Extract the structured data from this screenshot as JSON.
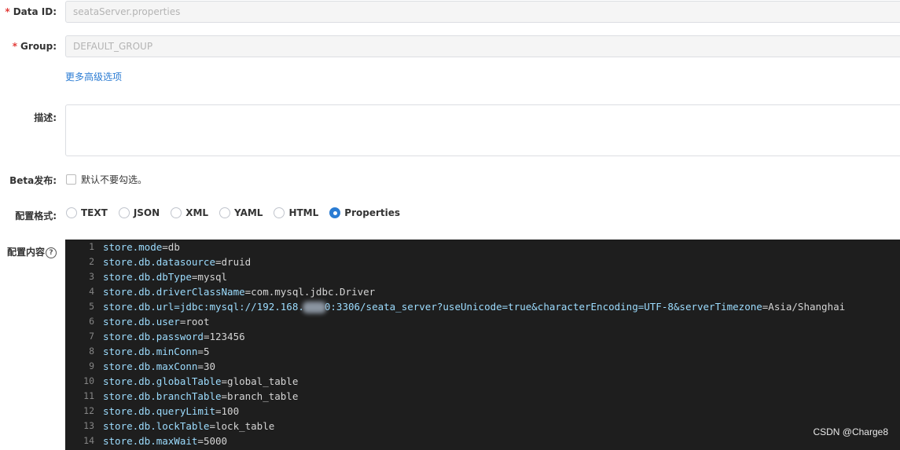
{
  "form": {
    "data_id": {
      "label": "Data ID:",
      "value": "seataServer.properties"
    },
    "group": {
      "label": "Group:",
      "value": "DEFAULT_GROUP"
    },
    "more_options_link": "更多高级选项",
    "description": {
      "label": "描述:",
      "value": ""
    },
    "beta": {
      "label": "Beta发布:",
      "checkbox_text": "默认不要勾选。",
      "checked": false
    },
    "format": {
      "label": "配置格式:",
      "options": [
        "TEXT",
        "JSON",
        "XML",
        "YAML",
        "HTML",
        "Properties"
      ],
      "selected": "Properties"
    },
    "content": {
      "label": "配置内容"
    }
  },
  "editor": {
    "lines": [
      {
        "n": "1",
        "key": "store.mode",
        "val": "=db"
      },
      {
        "n": "2",
        "key": "store.db.datasource",
        "val": "=druid"
      },
      {
        "n": "3",
        "key": "store.db.dbType",
        "val": "=mysql"
      },
      {
        "n": "4",
        "key": "store.db.driverClassName",
        "val": "=com.mysql.jdbc.Driver"
      },
      {
        "n": "5",
        "key": "store.db.url=jdbc:mysql://192.168.",
        "val": "",
        "redacted": true,
        "tail_key": "0:3306/seata_server?useUnicode=true&characterEncoding=UTF-8&serverTimezone",
        "tail_val": "=Asia/Shanghai"
      },
      {
        "n": "6",
        "key": "store.db.user",
        "val": "=root"
      },
      {
        "n": "7",
        "key": "store.db.password",
        "val": "=123456"
      },
      {
        "n": "8",
        "key": "store.db.minConn",
        "val": "=5"
      },
      {
        "n": "9",
        "key": "store.db.maxConn",
        "val": "=30"
      },
      {
        "n": "10",
        "key": "store.db.globalTable",
        "val": "=global_table"
      },
      {
        "n": "11",
        "key": "store.db.branchTable",
        "val": "=branch_table"
      },
      {
        "n": "12",
        "key": "store.db.queryLimit",
        "val": "=100"
      },
      {
        "n": "13",
        "key": "store.db.lockTable",
        "val": "=lock_table"
      },
      {
        "n": "14",
        "key": "store.db.maxWait",
        "val": "=5000"
      }
    ]
  },
  "watermark": "CSDN @Charge8",
  "colors": {
    "accent": "#2b7cd3",
    "required": "#e23c39",
    "editor_bg": "#1e1e1e",
    "key": "#9cdcfe"
  }
}
